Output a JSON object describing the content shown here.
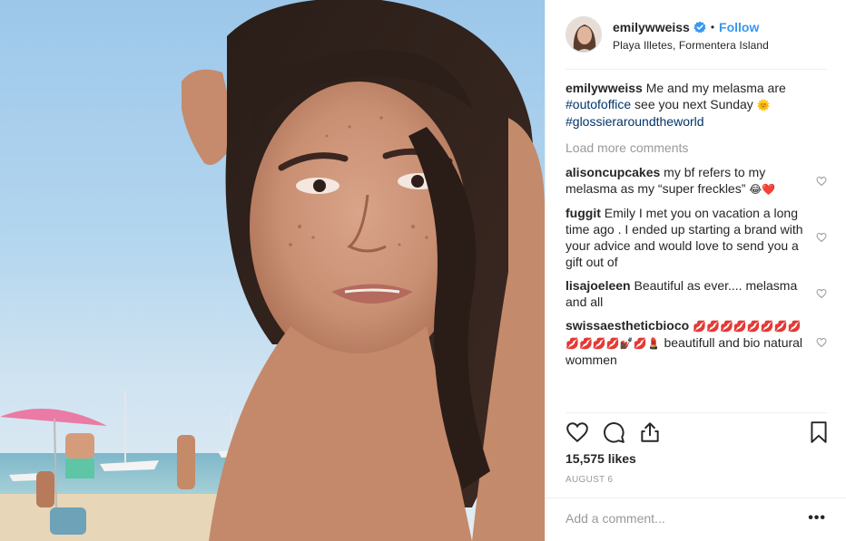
{
  "post": {
    "username": "emilywweiss",
    "location": "Playa Illetes, Formentera Island",
    "follow_label": "Follow",
    "dot": "•",
    "caption": {
      "username": "emilywweiss",
      "text_1": "Me and my melasma are",
      "tag_1": "#outofoffice",
      "text_2": "see you next Sunday",
      "emoji": "🌞",
      "tag_2": "#glossieraroundtheworld"
    },
    "load_more_label": "Load more comments",
    "comments": [
      {
        "user": "alisoncupcakes",
        "text": "my bf refers to my melasma as my “super freckles”",
        "emoji": "😂❤️"
      },
      {
        "user": "fuggit",
        "text": "Emily I met you on vacation a long time ago . I ended up starting a brand with your advice and would love to send you a gift out of",
        "emoji": ""
      },
      {
        "user": "lisajoeleen",
        "text": "Beautiful as ever.... melasma and all",
        "emoji": ""
      },
      {
        "user": "swissaestheticbioco",
        "text": "beautifull and bio natural wommen",
        "emoji": "💋💋💋💋💋💋💋💋💋💋💋💋💅🏿💋💄"
      }
    ],
    "likes": "15,575 likes",
    "date": "AUGUST 6",
    "add_comment_placeholder": "Add a comment...",
    "more_label": "•••"
  },
  "icons": {
    "verified": "verified-badge-icon",
    "heart": "heart-icon",
    "comment": "comment-icon",
    "share": "share-icon",
    "bookmark": "bookmark-icon"
  },
  "colors": {
    "link_blue": "#3897f0",
    "hashtag": "#003569",
    "muted": "#999999",
    "text": "#262626"
  }
}
